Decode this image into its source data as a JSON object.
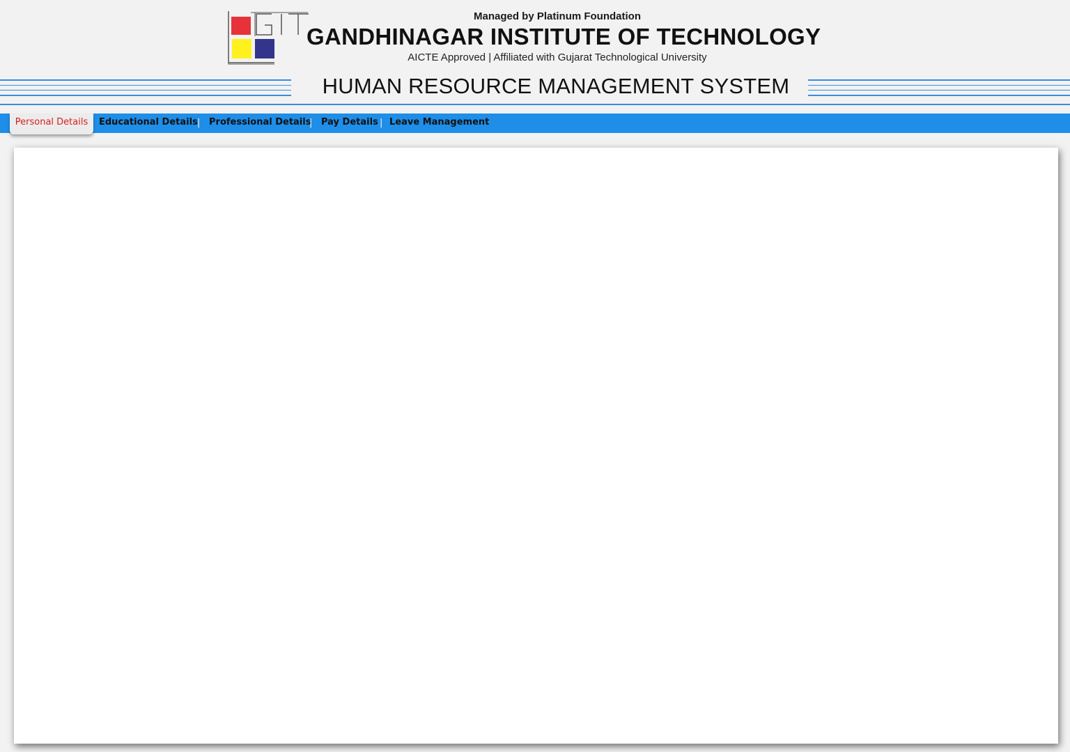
{
  "header": {
    "managed_by": "Managed by Platinum Foundation",
    "institute_name": "GANDHINAGAR INSTITUTE OF TECHNOLOGY",
    "approval": "AICTE Approved | Affiliated with Gujarat Technological University",
    "logo_text": "GIT",
    "logo_colors": {
      "red": "#e8323a",
      "yellow": "#fff11e",
      "navy": "#33358c",
      "outline": "#555555"
    }
  },
  "system_title": "HUMAN RESOURCE MANAGEMENT SYSTEM",
  "colors": {
    "accent_blue": "#1e8ee8",
    "active_tab_text": "#d42020",
    "stripe_blue": "#3a8be0"
  },
  "nav": {
    "items": [
      {
        "label": "Personal Details",
        "active": true
      },
      {
        "label": "Educational Details",
        "active": false
      },
      {
        "label": "Professional Details",
        "active": false
      },
      {
        "label": "Pay Details",
        "active": false
      },
      {
        "label": "Leave Management",
        "active": false
      }
    ],
    "separator": "|"
  }
}
